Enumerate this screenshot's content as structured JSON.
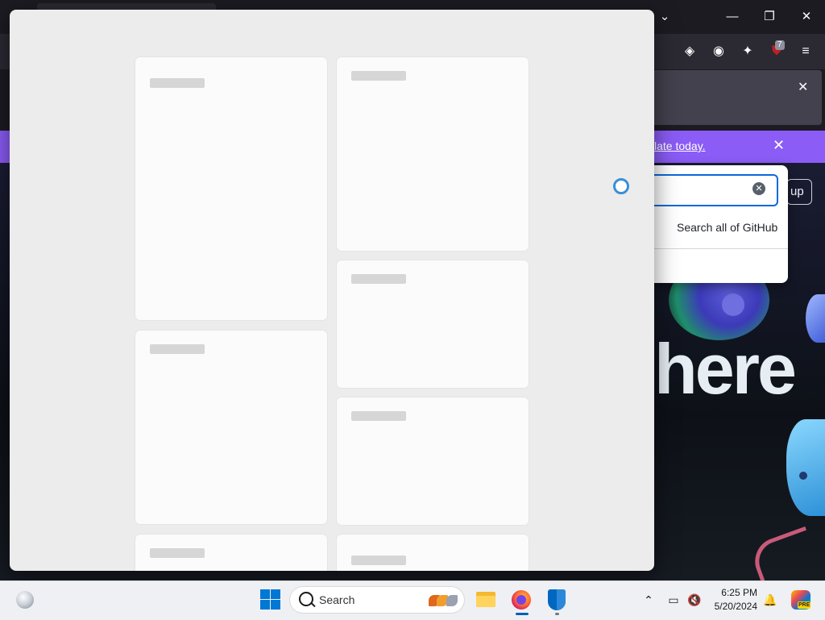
{
  "browser": {
    "extension_badge": "7",
    "banner_link": "late today.",
    "github": {
      "headline": "here",
      "signup_label": "up",
      "search_all_label": "Search all of GitHub"
    }
  },
  "overlay": {
    "cards": [
      {
        "id": "card-1"
      },
      {
        "id": "card-2"
      },
      {
        "id": "card-3"
      },
      {
        "id": "card-4"
      },
      {
        "id": "card-5"
      },
      {
        "id": "card-6"
      },
      {
        "id": "card-7"
      }
    ]
  },
  "taskbar": {
    "search_placeholder": "Search",
    "time": "6:25 PM",
    "date": "5/20/2024",
    "copilot_badge": "PRE"
  },
  "colors": {
    "overlay_bg": "#ececec",
    "card_bg": "#fbfbfb",
    "banner": "#8b5cf6",
    "accent": "#0078d4"
  },
  "icons": [
    "pocket-icon",
    "account-icon",
    "extensions-icon",
    "ublock-icon",
    "menu-icon",
    "search-icon",
    "windows-start-icon",
    "file-explorer-icon",
    "firefox-icon",
    "defender-icon",
    "chevron-up-icon",
    "network-icon",
    "volume-muted-icon",
    "notification-bell-icon",
    "copilot-icon",
    "weather-icon"
  ]
}
